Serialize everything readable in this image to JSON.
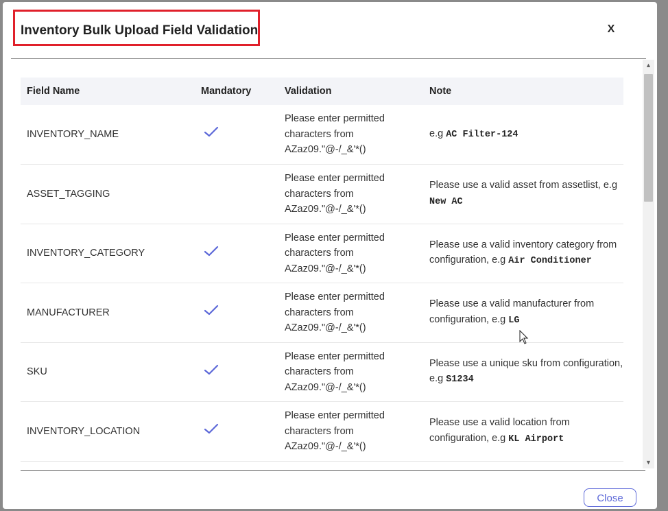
{
  "dialog": {
    "title": "Inventory Bulk Upload Field Validation",
    "close_x": "X",
    "close_button": "Close"
  },
  "table": {
    "headers": [
      "Field Name",
      "Mandatory",
      "Validation",
      "Note"
    ],
    "rows": [
      {
        "field": "INVENTORY_NAME",
        "mandatory": true,
        "validation": "Please enter permitted characters from AZaz09.\"@-/_&'*()",
        "note_text": "e.g ",
        "note_code": "AC Filter-124"
      },
      {
        "field": "ASSET_TAGGING",
        "mandatory": false,
        "validation": "Please enter permitted characters from AZaz09.\"@-/_&'*()",
        "note_text": "Please use a valid asset from assetlist, e.g ",
        "note_code": "New AC"
      },
      {
        "field": "INVENTORY_CATEGORY",
        "mandatory": true,
        "validation": "Please enter permitted characters from AZaz09.\"@-/_&'*()",
        "note_text": "Please use a valid inventory category from configuration, e.g ",
        "note_code": "Air Conditioner"
      },
      {
        "field": "MANUFACTURER",
        "mandatory": true,
        "validation": "Please enter permitted characters from AZaz09.\"@-/_&'*()",
        "note_text": "Please use a valid manufacturer from configuration, e.g ",
        "note_code": "LG"
      },
      {
        "field": "SKU",
        "mandatory": true,
        "validation": "Please enter permitted characters from AZaz09.\"@-/_&'*()",
        "note_text": "Please use a unique sku from configuration, e.g ",
        "note_code": "S1234"
      },
      {
        "field": "INVENTORY_LOCATION",
        "mandatory": true,
        "validation": "Please enter permitted characters from AZaz09.\"@-/_&'*()",
        "note_text": "Please use a valid location from configuration, e.g ",
        "note_code": "KL Airport"
      }
    ]
  },
  "icons": {
    "check": "check-icon",
    "close": "close-icon",
    "scroll_up": "triangle-up-icon",
    "scroll_down": "triangle-down-icon",
    "cursor": "mouse-pointer-icon"
  },
  "colors": {
    "accent": "#5b67d8",
    "highlight_border": "#e0202a"
  }
}
